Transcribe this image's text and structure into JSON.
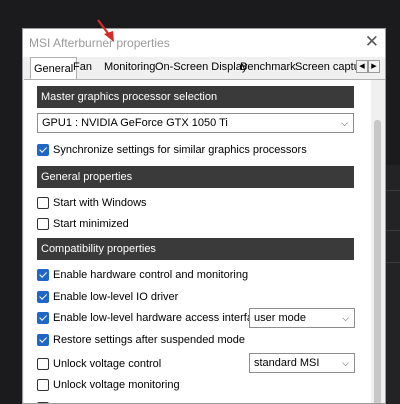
{
  "window": {
    "title": "MSI Afterburner properties",
    "close_glyph": "✕"
  },
  "tabs": [
    {
      "label": "General",
      "active": true
    },
    {
      "label": "Fan"
    },
    {
      "label": "Monitoring"
    },
    {
      "label": "On-Screen Display"
    },
    {
      "label": "Benchmark"
    },
    {
      "label": "Screen captu"
    }
  ],
  "tab_scroll": {
    "left_glyph": "◀",
    "right_glyph": "▶"
  },
  "sections": {
    "master": "Master graphics processor selection",
    "general": "General properties",
    "compat": "Compatibility properties"
  },
  "gpu_select": {
    "value": "GPU1 : NVIDIA GeForce GTX 1050 Ti"
  },
  "checkboxes": {
    "sync": {
      "label": "Synchronize settings for similar graphics processors",
      "checked": true
    },
    "start_windows": {
      "label": "Start with Windows",
      "checked": false
    },
    "start_min": {
      "label": "Start minimized",
      "checked": false
    },
    "hw_control": {
      "label": "Enable hardware control and monitoring",
      "checked": true
    },
    "low_io": {
      "label": "Enable low-level IO driver",
      "checked": true
    },
    "low_hw": {
      "label": "Enable low-level hardware access interface",
      "checked": true
    },
    "restore": {
      "label": "Restore settings after suspended mode",
      "checked": true
    },
    "unlock_ctrl": {
      "label": "Unlock voltage control",
      "checked": false
    },
    "unlock_mon": {
      "label": "Unlock voltage monitoring",
      "checked": false
    }
  },
  "low_hw_select": {
    "value": "user mode"
  },
  "voltage_select": {
    "value": "standard MSI"
  },
  "colors": {
    "accent": "#1f66c7",
    "section_bg": "#3a3a3a",
    "annotation_arrow": "#d42a2a"
  },
  "icons": {
    "close": "close-icon",
    "chevron": "chevron-down-icon",
    "arrow": "annotation-arrow"
  }
}
